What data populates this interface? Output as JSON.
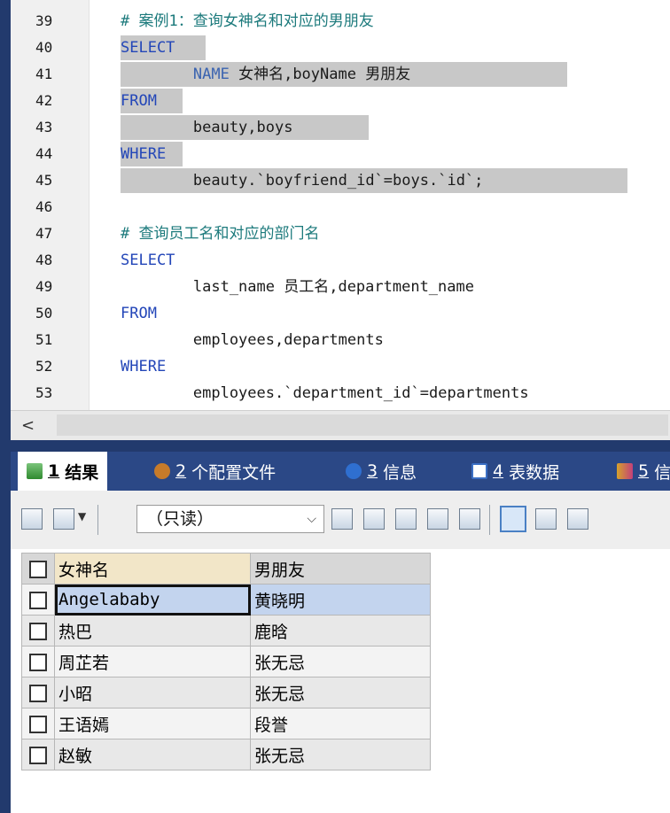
{
  "editor": {
    "lines": [
      {
        "num": "39",
        "segments": [
          {
            "t": "# 案例1：查询女神名和对应的男朋友",
            "c": "cm"
          }
        ]
      },
      {
        "num": "40",
        "segments": [
          {
            "t": "SELECT",
            "c": "kw"
          }
        ]
      },
      {
        "num": "41",
        "segments": [
          {
            "t": "        ",
            "c": "txt"
          },
          {
            "t": "NAME",
            "c": "fn"
          },
          {
            "t": " 女神名,boyName 男朋友",
            "c": "txt"
          }
        ]
      },
      {
        "num": "42",
        "segments": [
          {
            "t": "FROM",
            "c": "kw"
          }
        ]
      },
      {
        "num": "43",
        "segments": [
          {
            "t": "        beauty,boys",
            "c": "txt"
          }
        ]
      },
      {
        "num": "44",
        "segments": [
          {
            "t": "WHERE",
            "c": "kw"
          }
        ]
      },
      {
        "num": "45",
        "segments": [
          {
            "t": "        beauty.`boyfriend_id`=boys.`id`;",
            "c": "txt"
          }
        ]
      },
      {
        "num": "46",
        "segments": []
      },
      {
        "num": "47",
        "segments": [
          {
            "t": "# 查询员工名和对应的部门名",
            "c": "cm"
          }
        ]
      },
      {
        "num": "48",
        "segments": [
          {
            "t": "SELECT",
            "c": "kw"
          }
        ]
      },
      {
        "num": "49",
        "segments": [
          {
            "t": "        last_name 员工名,department_name",
            "c": "txt"
          }
        ]
      },
      {
        "num": "50",
        "segments": [
          {
            "t": "FROM",
            "c": "kw"
          }
        ]
      },
      {
        "num": "51",
        "segments": [
          {
            "t": "        employees,departments",
            "c": "txt"
          }
        ]
      },
      {
        "num": "52",
        "segments": [
          {
            "t": "WHERE",
            "c": "kw"
          }
        ]
      },
      {
        "num": "53",
        "segments": [
          {
            "t": "        employees.`department_id`=departments",
            "c": "txt"
          }
        ]
      }
    ]
  },
  "scrollbar": {
    "left_arrow": "<"
  },
  "tabs": [
    {
      "num": "1",
      "label": "结果",
      "icon": "grid-icon",
      "color": "#3a8a3a"
    },
    {
      "num": "2",
      "label": "个配置文件",
      "icon": "profile-icon",
      "color": "#c77b2a"
    },
    {
      "num": "3",
      "label": "信息",
      "icon": "info-icon",
      "color": "#2f6fd0"
    },
    {
      "num": "4",
      "label": "表数据",
      "icon": "table-icon",
      "color": "#3b6fc4"
    },
    {
      "num": "5",
      "label": "信",
      "icon": "chart-icon",
      "color": "#d6a22b"
    }
  ],
  "toolbar": {
    "readonly_label": "（只读）",
    "chevron": "⌵"
  },
  "grid": {
    "headers": [
      "女神名",
      "男朋友"
    ],
    "rows": [
      [
        "Angelababy",
        "黄晓明"
      ],
      [
        "热巴",
        "鹿晗"
      ],
      [
        "周芷若",
        "张无忌"
      ],
      [
        "小昭",
        "张无忌"
      ],
      [
        "王语嫣",
        "段誉"
      ],
      [
        "赵敏",
        "张无忌"
      ]
    ]
  }
}
